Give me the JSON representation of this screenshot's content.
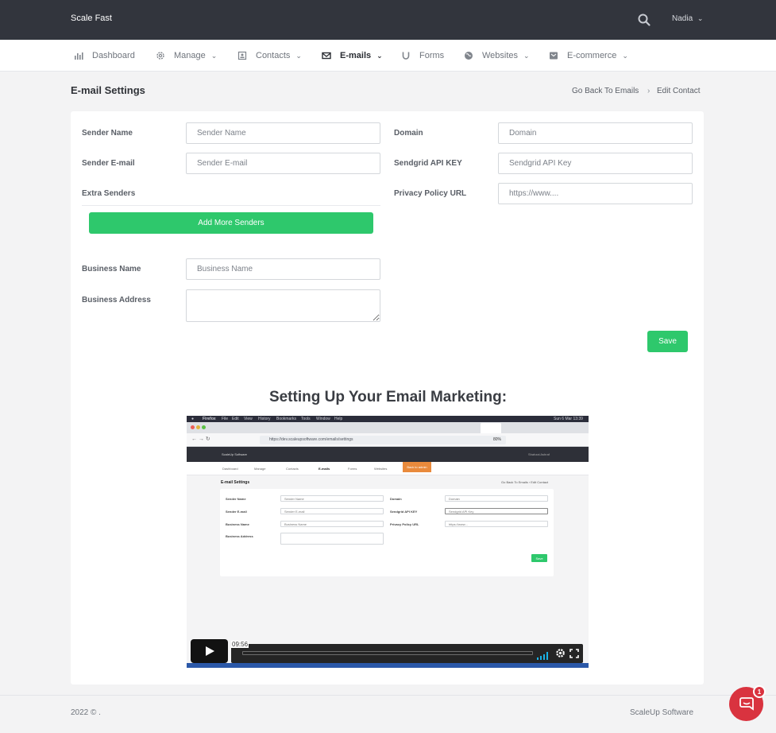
{
  "header": {
    "brand": "Scale Fast",
    "user_name": "Nadia",
    "user_chevron": "⌄"
  },
  "nav": {
    "items": [
      {
        "label": "Dashboard",
        "icon": "bar-chart-icon",
        "has_chevron": false
      },
      {
        "label": "Manage",
        "icon": "gear-icon",
        "has_chevron": true
      },
      {
        "label": "Contacts",
        "icon": "contacts-icon",
        "has_chevron": true
      },
      {
        "label": "E-mails",
        "icon": "envelope-icon",
        "has_chevron": true,
        "active": true
      },
      {
        "label": "Forms",
        "icon": "magnet-icon",
        "has_chevron": false
      },
      {
        "label": "Websites",
        "icon": "globe-icon",
        "has_chevron": true
      },
      {
        "label": "E-commerce",
        "icon": "shop-icon",
        "has_chevron": true
      }
    ],
    "chevron": "⌄"
  },
  "page": {
    "title": "E-mail Settings",
    "breadcrumb": {
      "back_link": "Go Back To Emails",
      "separator": "›",
      "current": "Edit Contact"
    }
  },
  "form": {
    "sender_name": {
      "label": "Sender Name",
      "placeholder": "Sender Name",
      "value": ""
    },
    "sender_email": {
      "label": "Sender E-mail",
      "placeholder": "Sender E-mail",
      "value": ""
    },
    "extra_senders": {
      "label": "Extra Senders"
    },
    "add_senders_button": "Add More Senders",
    "business_name": {
      "label": "Business Name",
      "placeholder": "Business Name",
      "value": ""
    },
    "business_address": {
      "label": "Business Address",
      "value": ""
    },
    "domain": {
      "label": "Domain",
      "placeholder": "Domain",
      "value": ""
    },
    "sendgrid": {
      "label": "Sendgrid API KEY",
      "placeholder": "Sendgrid API Key",
      "value": ""
    },
    "privacy": {
      "label": "Privacy Policy URL",
      "placeholder": "https://www....",
      "value": ""
    },
    "save_button": "Save"
  },
  "video": {
    "heading": "Setting Up Your Email Marketing:",
    "time": "09:56",
    "progress": 0.0,
    "inner": {
      "os_app": "Firefox",
      "os_menus": [
        "File",
        "Edit",
        "View",
        "History",
        "Bookmarks",
        "Tools",
        "Window",
        "Help"
      ],
      "os_clock": "Sun 6 Mar 13:39",
      "url": "https://dev.scaleupsoftware.com/emails/settings",
      "zoom": "80%",
      "brand": "ScaleUp Software",
      "user": "Shahzai Ashraf",
      "nav_items": [
        "Dashboard",
        "Manage",
        "Contacts",
        "E-mails",
        "Forms",
        "Websites"
      ],
      "admin_button": "Back to admin",
      "title": "E-mail Settings",
      "crumb": "Go Back To Emails  ›  Edit Contact",
      "labels": {
        "sender_name": "Sender Name",
        "sender_email": "Sender E-mail",
        "business_name": "Business Name",
        "business_address": "Business Address",
        "domain": "Domain",
        "sendgrid": "Sendgrid API KEY",
        "privacy": "Privacy Policy URL"
      },
      "values": {
        "sender_name": "Sender Name",
        "sender_email": "Sender E-mail",
        "business_name": "Business Name",
        "domain": "Domain",
        "sendgrid": "Sendgrid API Key",
        "privacy": "https://www..."
      },
      "save": "Save"
    }
  },
  "footer": {
    "copyright": "2022 © .",
    "company": "ScaleUp Software"
  },
  "chat": {
    "badge": "1"
  },
  "colors": {
    "topbar": "#32353d",
    "accent_green": "#2ec86c",
    "chat_red": "#d9333f"
  }
}
